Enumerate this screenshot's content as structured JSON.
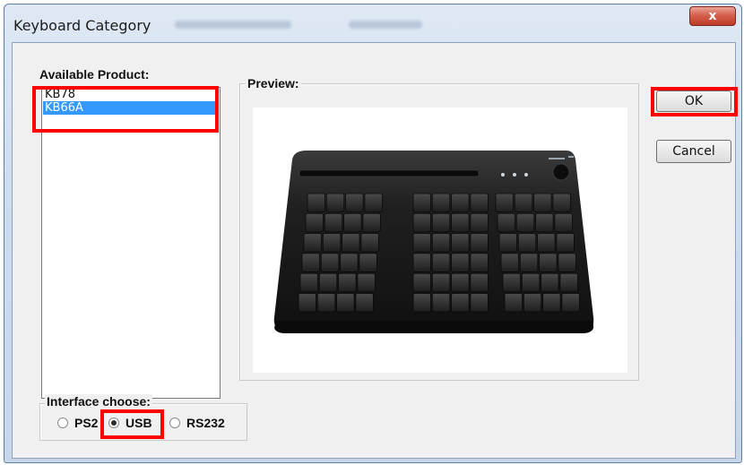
{
  "window": {
    "title": "Keyboard Category",
    "close_label": "x"
  },
  "product": {
    "label": "Available Product:",
    "items": [
      "KB78",
      "KB66A"
    ],
    "selected": "KB66A"
  },
  "preview": {
    "label": "Preview:"
  },
  "buttons": {
    "ok_label": "OK",
    "cancel_label": "Cancel"
  },
  "interface": {
    "label": "Interface choose:",
    "options": [
      "PS2",
      "USB",
      "RS232"
    ],
    "selected": "USB"
  },
  "colors": {
    "highlight_box": "#ff0000",
    "selection": "#3399ff",
    "keyboard_body": "#1c1c1c"
  }
}
